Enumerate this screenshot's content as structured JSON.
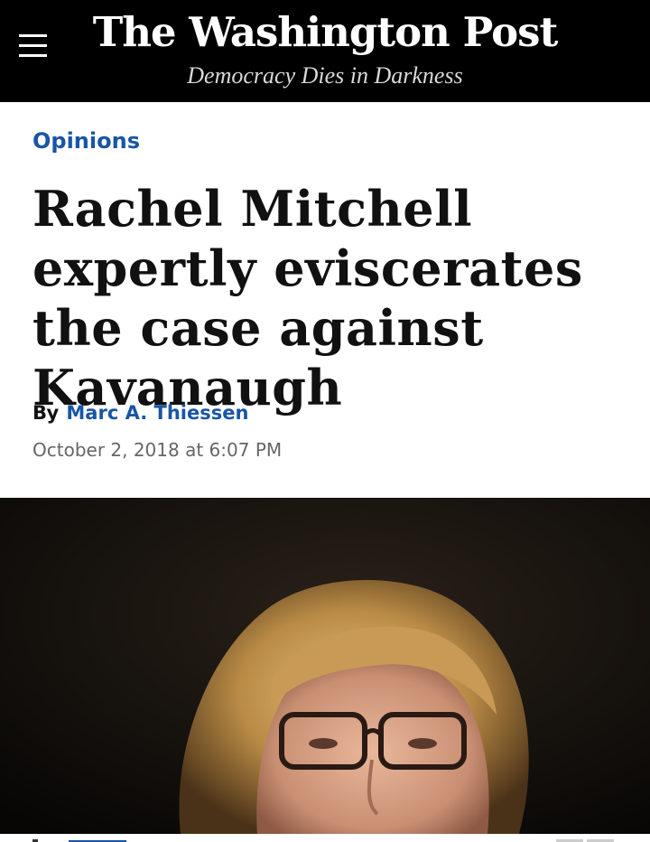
{
  "header": {
    "masthead": "The Washington Post",
    "tagline": "Democracy Dies in Darkness",
    "menu_icon": "hamburger-menu-icon"
  },
  "article": {
    "section": "Opinions",
    "headline": "Rachel Mitchell expertly eviscerates the case against Kavanaugh",
    "byline_prefix": "By",
    "author": "Marc A. Thiessen",
    "date": "October 2, 2018 at 6:07 PM"
  },
  "colors": {
    "header_background": "#000000",
    "link_blue": "#1955a5",
    "headline_text": "#111111",
    "date_text": "#666666"
  }
}
